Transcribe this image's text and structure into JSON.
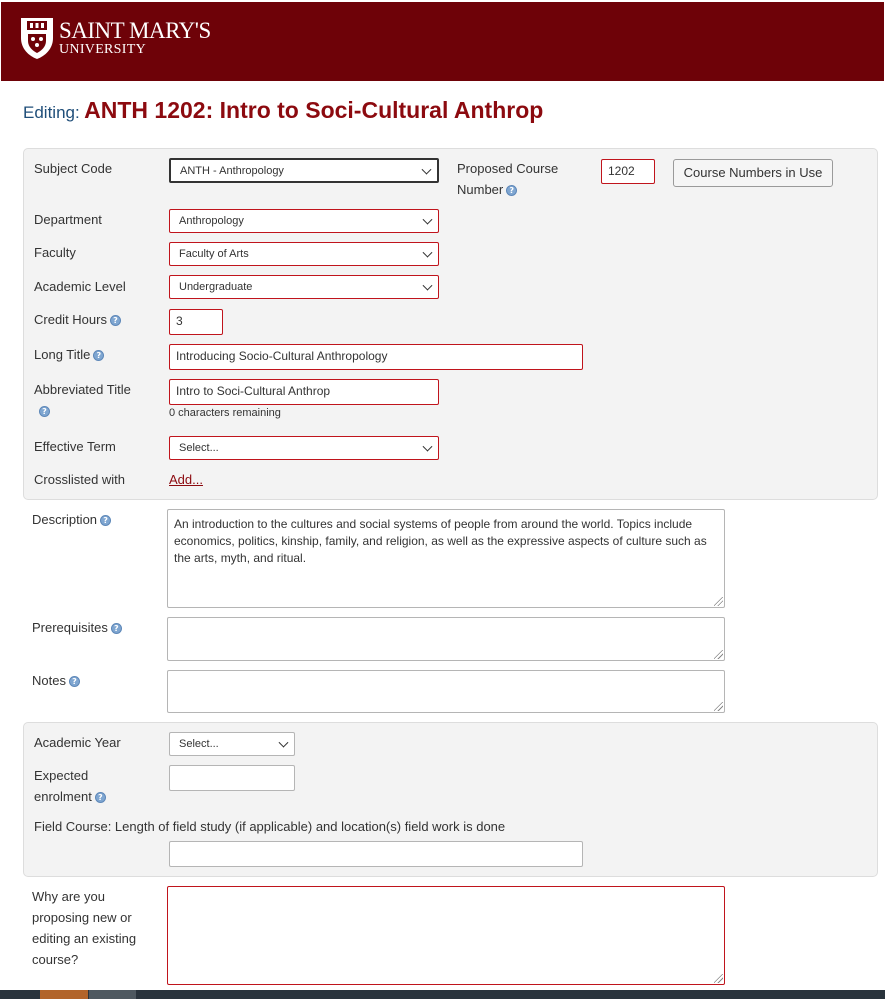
{
  "header": {
    "logo_line1": "SAINT MARY'S",
    "logo_line2": "UNIVERSITY",
    "brand_color": "#6e0208"
  },
  "title": {
    "prefix": "Editing:",
    "course": "ANTH 1202: Intro to Soci-Cultural Anthrop"
  },
  "icons": {
    "help": "help-icon",
    "dropdown": "chevron-down-icon",
    "logo": "shield-crest-icon"
  },
  "form": {
    "subject_code": {
      "label": "Subject Code",
      "value": "ANTH - Anthropology"
    },
    "proposed_number": {
      "label": "Proposed Course Number",
      "value": "1202"
    },
    "numbers_in_use_button": "Course Numbers in Use",
    "department": {
      "label": "Department",
      "value": "Anthropology"
    },
    "faculty": {
      "label": "Faculty",
      "value": "Faculty of Arts"
    },
    "academic_level": {
      "label": "Academic Level",
      "value": "Undergraduate"
    },
    "credit_hours": {
      "label": "Credit Hours",
      "value": "3"
    },
    "long_title": {
      "label": "Long Title",
      "value": "Introducing Socio-Cultural Anthropology"
    },
    "abbreviated_title": {
      "label": "Abbreviated Title",
      "value": "Intro to Soci-Cultural Anthrop",
      "remaining": "0 characters remaining"
    },
    "effective_term": {
      "label": "Effective Term",
      "value": "Select..."
    },
    "crosslisted": {
      "label": "Crosslisted with",
      "link": "Add..."
    },
    "description": {
      "label": "Description",
      "value": "An introduction to the cultures and social systems of people from around the world. Topics include economics, politics, kinship, family, and religion, as well as the expressive aspects of culture such as the arts, myth, and ritual."
    },
    "prerequisites": {
      "label": "Prerequisites",
      "value": ""
    },
    "notes": {
      "label": "Notes",
      "value": ""
    },
    "academic_year": {
      "label": "Academic Year",
      "value": "Select..."
    },
    "expected_enrolment": {
      "label": "Expected enrolment",
      "value": ""
    },
    "field_course": {
      "label": "Field Course: Length of field study (if applicable) and location(s) field work is done",
      "value": ""
    },
    "why": {
      "label": "Why are you proposing new or editing an existing course?",
      "value": ""
    }
  }
}
